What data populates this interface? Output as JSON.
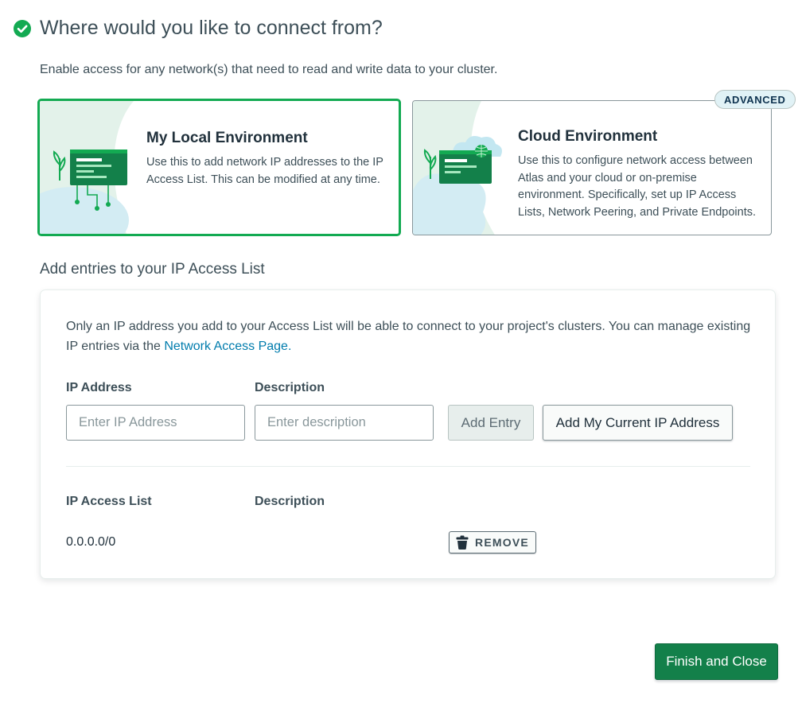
{
  "header": {
    "check_icon": "check-circle-icon",
    "title": "Where would you like to connect from?",
    "subtitle": "Enable access for any network(s) that need to read and write data to your cluster."
  },
  "options": {
    "local": {
      "title": "My Local Environment",
      "description": "Use this to add network IP addresses to the IP Access List. This can be modified at any time.",
      "selected": true
    },
    "cloud": {
      "title": "Cloud Environment",
      "description": "Use this to configure network access between Atlas and your cloud or on-premise environment. Specifically, set up IP Access Lists, Network Peering, and Private Endpoints.",
      "badge": "ADVANCED",
      "selected": false
    }
  },
  "access": {
    "section_title": "Add entries to your IP Access List",
    "info_text": "Only an IP address you add to your Access List will be able to connect to your project's clusters. You can manage existing IP entries via the ",
    "info_link": "Network Access Page.",
    "ip_label": "IP Address",
    "ip_placeholder": "Enter IP Address",
    "ip_value": "",
    "desc_label": "Description",
    "desc_placeholder": "Enter description",
    "desc_value": "",
    "add_entry_label": "Add Entry",
    "add_my_ip_label": "Add My Current IP Address",
    "list_header_ip": "IP Access List",
    "list_header_desc": "Description",
    "entries": [
      {
        "ip": "0.0.0.0/0",
        "description": "",
        "remove_label": "REMOVE",
        "remove_icon": "trash-icon"
      }
    ]
  },
  "footer": {
    "finish_label": "Finish and Close"
  },
  "colors": {
    "brand_green": "#13aa52",
    "button_green": "#13804a",
    "link_blue": "#007cad",
    "text": "#3d4f58",
    "badge_bg": "#e1f2f6"
  }
}
